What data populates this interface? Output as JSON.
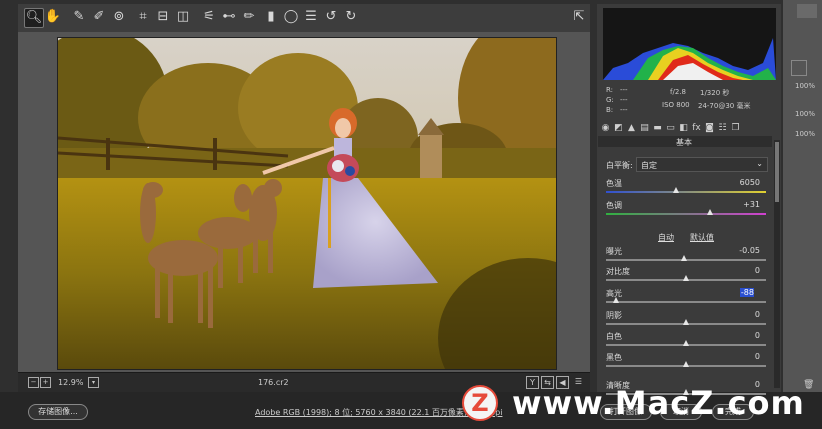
{
  "toolbar": {
    "tools": [
      "zoom-icon",
      "hand-icon",
      "white-balance-icon",
      "color-sampler-icon",
      "target-adjust-icon",
      "crop-icon",
      "straighten-icon",
      "transform-icon",
      "spot-removal-icon",
      "red-eye-icon",
      "adjustment-brush-icon",
      "graduated-filter-icon",
      "radial-filter-icon",
      "preferences-icon",
      "rotate-left-icon",
      "rotate-right-icon"
    ],
    "fullscreen_icon": "fullscreen-icon"
  },
  "view": {
    "zoom_level": "12.9%",
    "filename": "176.cr2",
    "view_modes": [
      "Y",
      "⇆",
      "◀",
      "☰"
    ]
  },
  "status": {
    "save_button": "存储图像...",
    "workflow_text": "Adobe RGB (1998); 8 位; 5760 x 3840 (22.1 百万像素); 300 ppi",
    "open_button": "打开图像",
    "cancel_button": "取消",
    "done_button": "完成"
  },
  "camera_info": {
    "rgb_labels": [
      "R:",
      "G:",
      "B:"
    ],
    "rgb_values": [
      "---",
      "---",
      "---"
    ],
    "aperture": "f/2.8",
    "shutter": "1/320 秒",
    "iso": "ISO 800",
    "lens": "24-70@30 毫米"
  },
  "panel": {
    "section_title": "基本",
    "white_balance_label": "白平衡:",
    "white_balance_value": "自定",
    "auto_label": "自动",
    "default_label": "默认值",
    "sliders": [
      {
        "label": "色温",
        "value": "6050",
        "position": 0.44
      },
      {
        "label": "色调",
        "value": "+31",
        "position": 0.65
      },
      {
        "label": "曝光",
        "value": "-0.05",
        "position": 0.49
      },
      {
        "label": "对比度",
        "value": "0",
        "position": 0.5
      },
      {
        "label": "高光",
        "value": "-88",
        "position": 0.06
      },
      {
        "label": "阴影",
        "value": "0",
        "position": 0.5
      },
      {
        "label": "白色",
        "value": "0",
        "position": 0.5
      },
      {
        "label": "黑色",
        "value": "0",
        "position": 0.5
      },
      {
        "label": "清晰度",
        "value": "0",
        "position": 0.5
      }
    ]
  },
  "far_right": {
    "percent_labels": [
      "100%",
      "100%",
      "100%"
    ]
  },
  "watermark": {
    "logo_letter": "Z",
    "text": "www.MacZ.com"
  }
}
